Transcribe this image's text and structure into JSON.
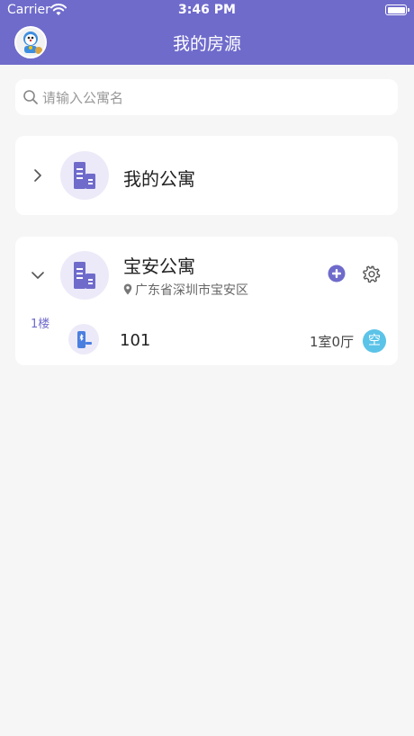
{
  "status_bar": {
    "carrier": "Carrier",
    "time": "3:46 PM"
  },
  "header": {
    "title": "我的房源"
  },
  "search": {
    "placeholder": "请输入公寓名"
  },
  "apartments": [
    {
      "name": "我的公寓",
      "expanded": false
    },
    {
      "name": "宝安公寓",
      "address": "广东省深圳市宝安区",
      "expanded": true,
      "floors": [
        {
          "label": "1楼",
          "rooms": [
            {
              "number": "101",
              "layout": "1室0厅",
              "status": "空"
            }
          ]
        }
      ]
    }
  ],
  "colors": {
    "accent": "#6f6bcb",
    "status_empty": "#5bc3e8",
    "background": "#f6f6f7"
  },
  "icons": {
    "search": "search-icon",
    "building": "building-icon",
    "add": "plus-circle-icon",
    "settings": "gear-icon",
    "location": "location-pin-icon",
    "lock": "bluetooth-lock-icon"
  }
}
